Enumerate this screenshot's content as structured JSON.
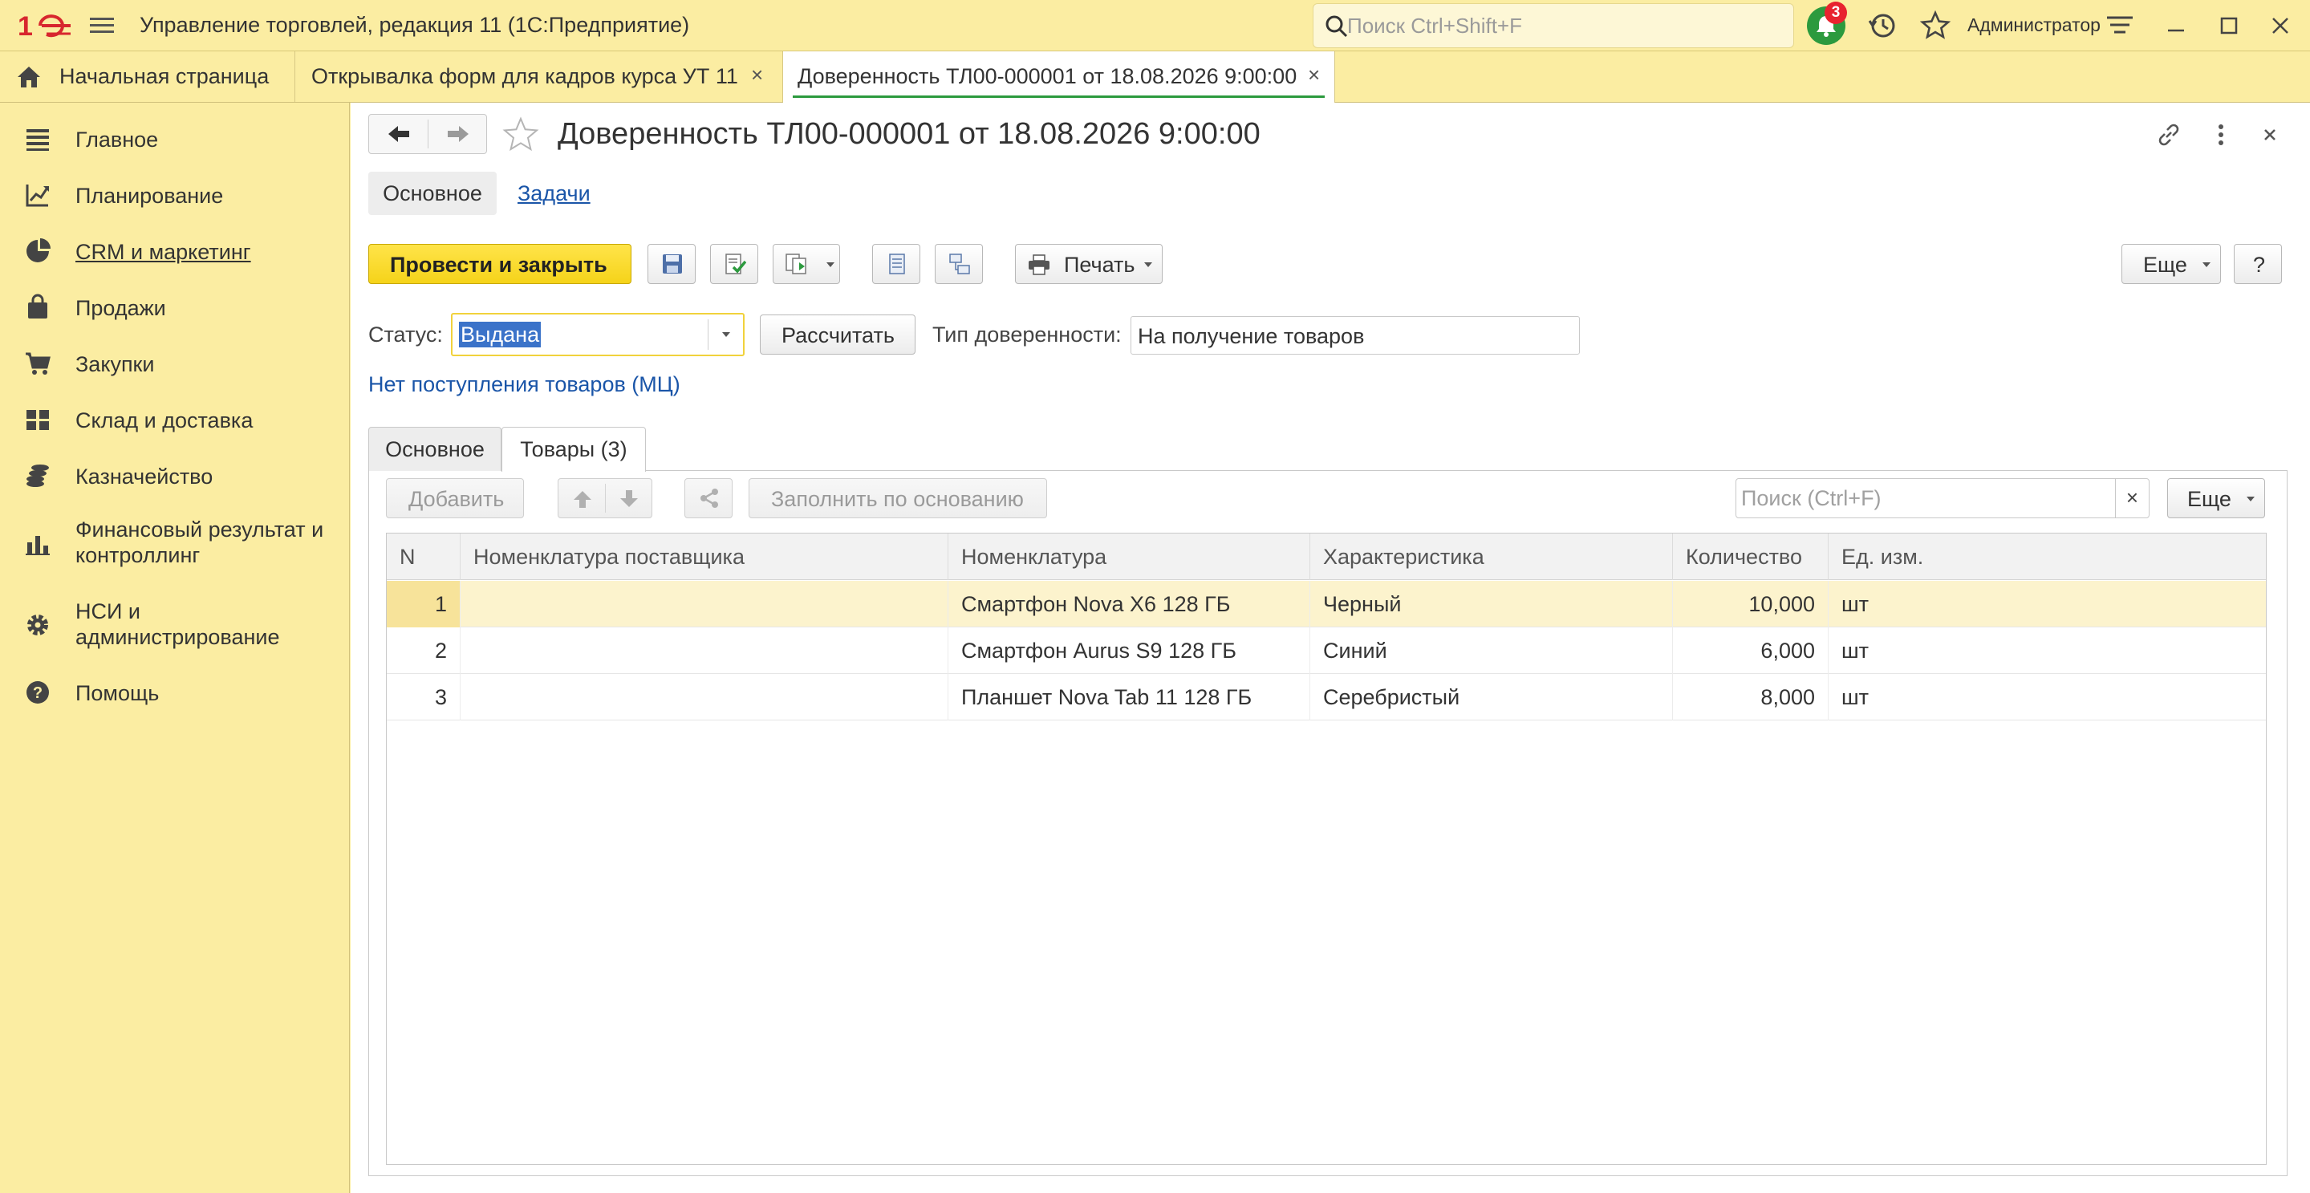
{
  "app": {
    "title": "Управление торговлей, редакция 11  (1С:Предприятие)",
    "search_placeholder": "Поиск Ctrl+Shift+F",
    "notifications_count": "3",
    "user": "Администратор",
    "icons": [
      "1c-logo-icon",
      "menu-icon",
      "search-icon",
      "bell-icon",
      "history-icon",
      "star-icon",
      "settings-icon",
      "minimize-icon",
      "maximize-icon",
      "close-icon"
    ]
  },
  "tabs": [
    {
      "label": "Начальная страница",
      "icon": "home-icon"
    },
    {
      "label": "Открывалка форм для кадров курса УТ 11"
    },
    {
      "label": "Доверенность ТЛ00-000001 от 18.08.2026 9:00:00",
      "active": true
    }
  ],
  "sidebar": {
    "items": [
      {
        "label": "Главное",
        "icon": "list-icon"
      },
      {
        "label": "Планирование",
        "icon": "planning-icon"
      },
      {
        "label": "CRM и маркетинг",
        "icon": "crm-icon"
      },
      {
        "label": "Продажи",
        "icon": "bag-icon"
      },
      {
        "label": "Закупки",
        "icon": "cart-icon"
      },
      {
        "label": "Склад и доставка",
        "icon": "warehouse-icon"
      },
      {
        "label": "Казначейство",
        "icon": "coins-icon"
      },
      {
        "label": "Финансовый результат и контроллинг",
        "icon": "bar-chart-icon"
      },
      {
        "label": "НСИ и администрирование",
        "icon": "gear-icon"
      },
      {
        "label": "Помощь",
        "icon": "help-icon"
      }
    ]
  },
  "form": {
    "title": "Доверенность ТЛ00-000001 от 18.08.2026 9:00:00",
    "form_tabs": {
      "main": "Основное",
      "tasks": "Задачи"
    },
    "toolbar": {
      "post_close": "Провести и закрыть",
      "print": "Печать",
      "more": "Еще",
      "help": "?"
    },
    "status_label": "Статус:",
    "status_value": "Выдана",
    "calculate": "Рассчитать",
    "type_label": "Тип доверенности:",
    "type_value": "На получение товаров",
    "link_no_receipts": "Нет поступления товаров (МЦ)",
    "page_tabs": {
      "main": "Основное",
      "goods": "Товары (3)"
    },
    "table_toolbar": {
      "add": "Добавить",
      "fill": "Заполнить по основанию",
      "search_placeholder": "Поиск (Ctrl+F)",
      "clear": "×",
      "more": "Еще"
    },
    "table": {
      "columns": [
        "N",
        "Номенклатура поставщика",
        "Номенклатура",
        "Характеристика",
        "Количество",
        "Ед. изм."
      ],
      "rows": [
        {
          "n": "1",
          "supplier_item": "",
          "item": "Смартфон Nova X6 128 ГБ",
          "characteristic": "Черный",
          "qty": "10,000",
          "unit": "шт",
          "selected": true
        },
        {
          "n": "2",
          "supplier_item": "",
          "item": "Смартфон Aurus S9 128 ГБ",
          "characteristic": "Синий",
          "qty": "6,000",
          "unit": "шт"
        },
        {
          "n": "3",
          "supplier_item": "",
          "item": "Планшет Nova Tab 11 128 ГБ",
          "characteristic": "Серебристый",
          "qty": "8,000",
          "unit": "шт"
        }
      ]
    }
  },
  "colors": {
    "chrome_bg": "#fbeda2",
    "accent_yellow": "#f5d31a",
    "selected_row": "#fcf3cd",
    "link": "#1a55a8",
    "green": "#2c9a3e",
    "badge_red": "#e8232f",
    "selection_blue": "#3b73c9"
  }
}
